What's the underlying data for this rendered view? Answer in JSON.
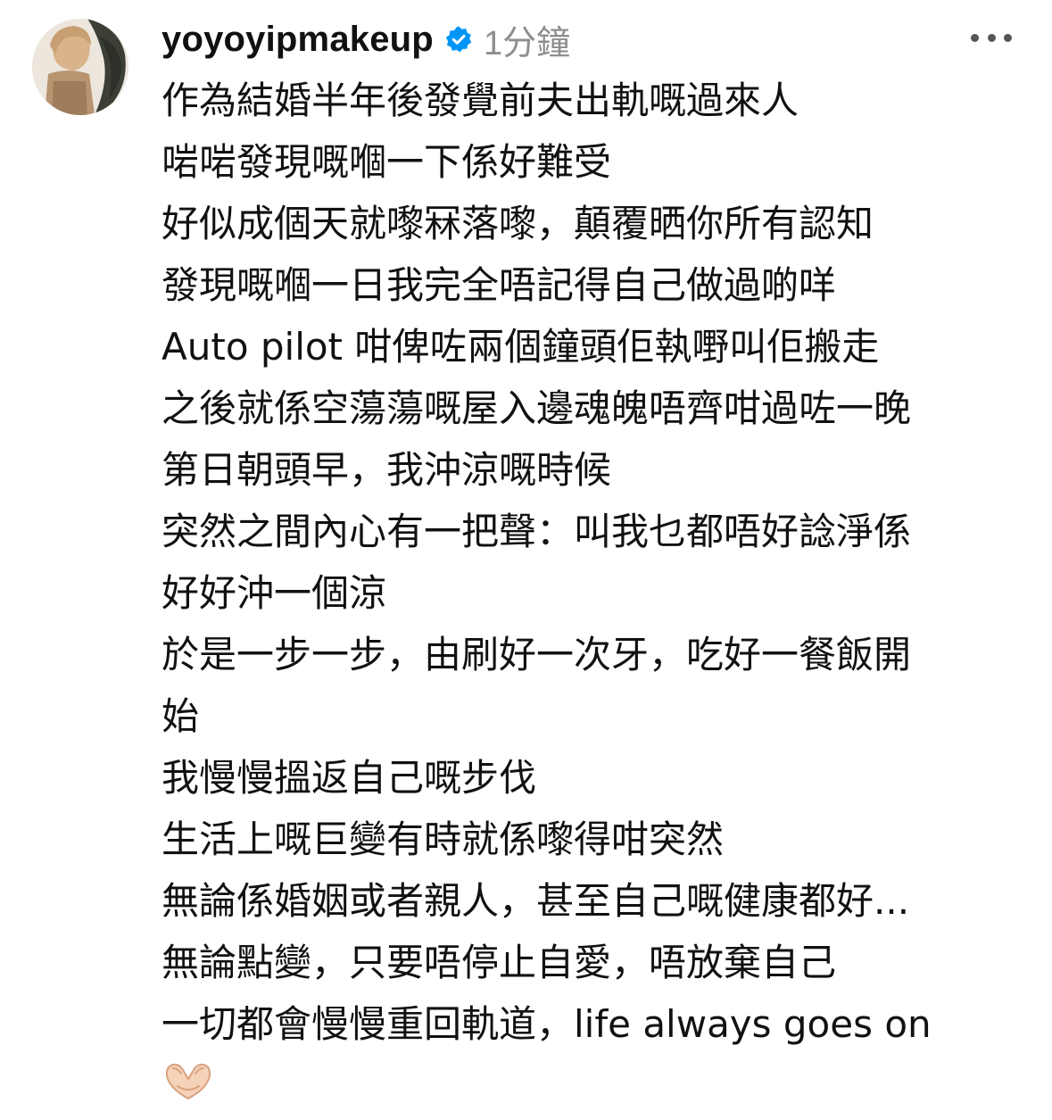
{
  "comment": {
    "username": "yoyoyipmakeup",
    "verified": true,
    "timestamp": "1分鐘",
    "lines": [
      "作為結婚半年後發覺前夫出軌嘅過來人",
      "啱啱發現嘅嗰一下係好難受",
      "好似成個天就嚟冧落嚟，顛覆晒你所有認知",
      "發現嘅嗰一日我完全唔記得自己做過啲咩",
      "Auto pilot 咁俾咗兩個鐘頭佢執嘢叫佢搬走",
      "之後就係空蕩蕩嘅屋入邊魂魄唔齊咁過咗一晚",
      "第日朝頭早，我沖涼嘅時候",
      "突然之間內心有一把聲：叫我乜都唔好諗淨係",
      "好好沖一個涼",
      "於是一步一步，由刷好一次牙，吃好一餐飯開",
      "始",
      "我慢慢搵返自己嘅步伐",
      "生活上嘅巨變有時就係嚟得咁突然",
      "無論係婚姻或者親人，甚至自己嘅健康都好...",
      "無論點變，只要唔停止自愛，唔放棄自己",
      "一切都會慢慢重回軌道，life always goes on"
    ],
    "emoji": "🫶🏻"
  },
  "icons": {
    "verified_badge": "verified-badge-icon",
    "more": "more-options-icon"
  },
  "colors": {
    "verified_blue": "#0095f6",
    "text": "#111111",
    "secondary": "#8e8e8e",
    "heart_hands": "#f5d2b8"
  }
}
